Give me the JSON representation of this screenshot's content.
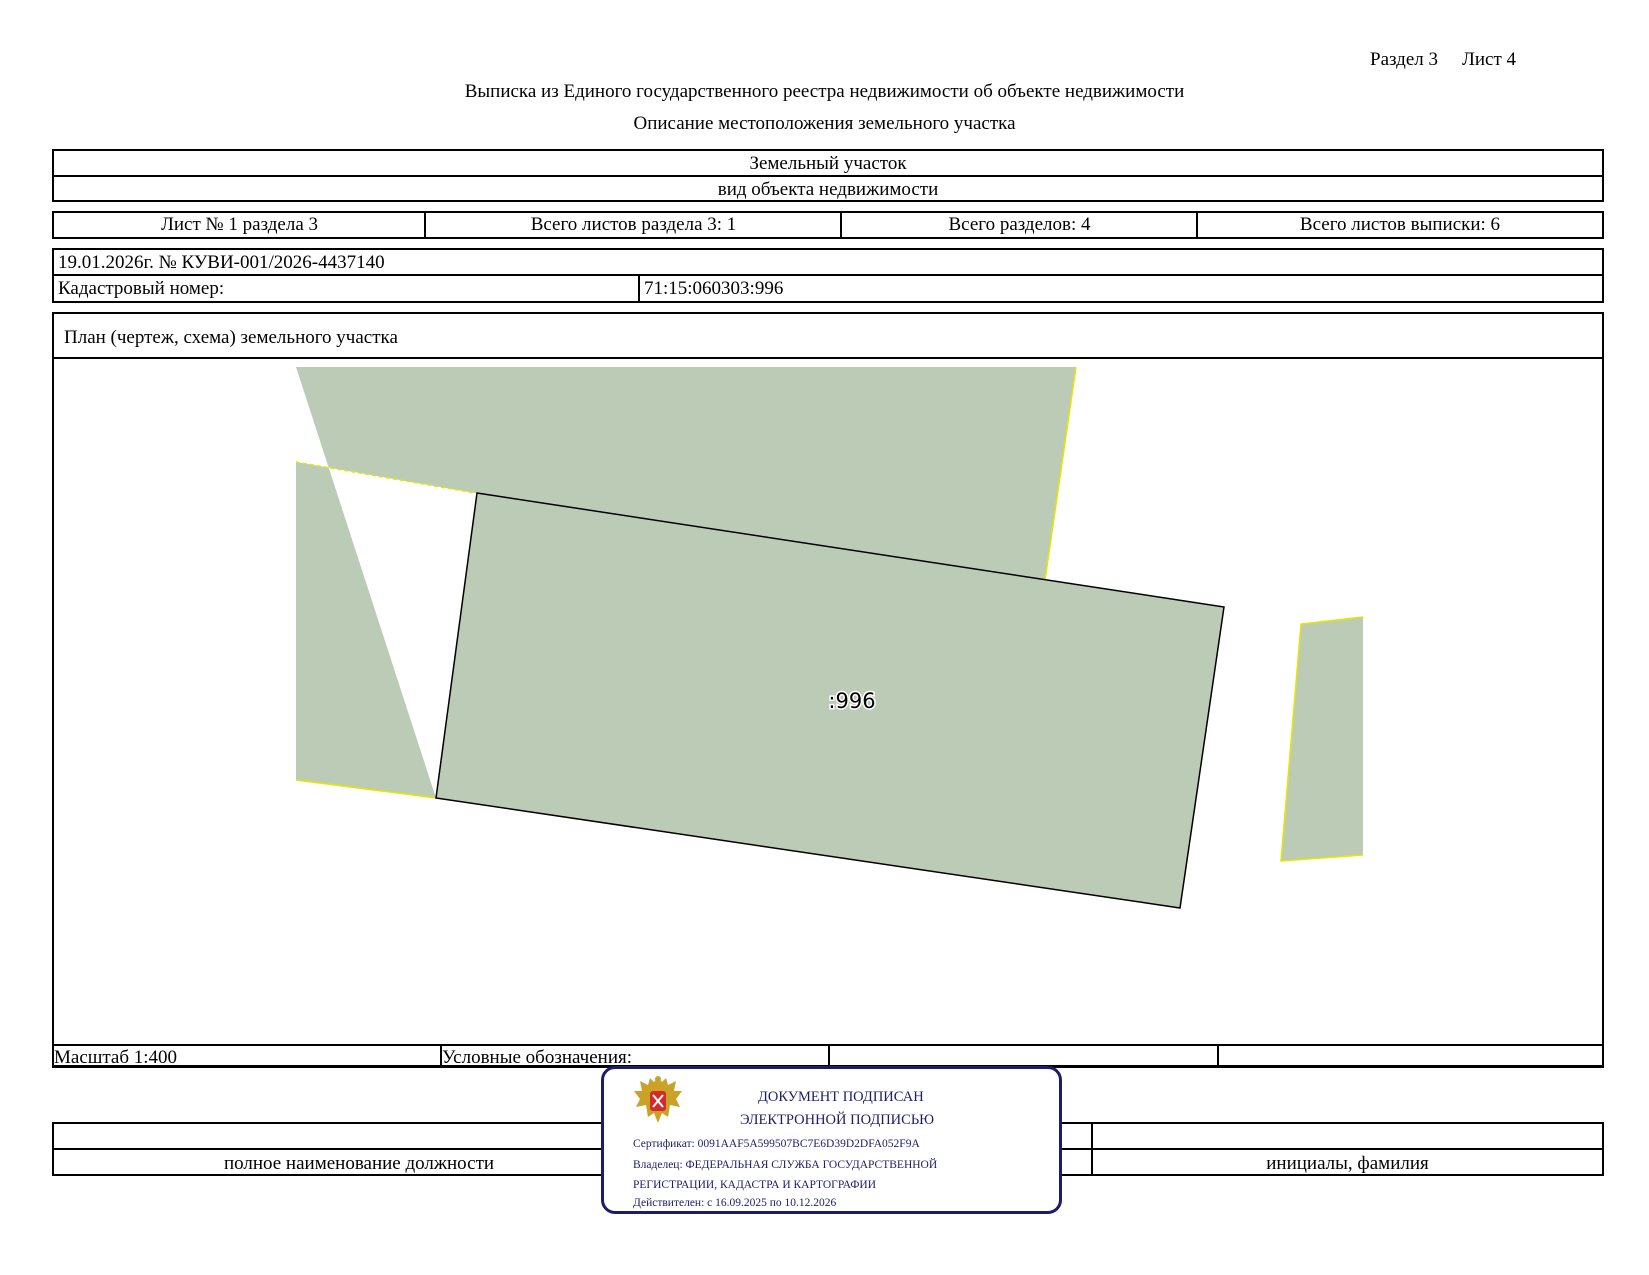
{
  "header": {
    "section_label": "Раздел 3",
    "sheet_label": "Лист 4",
    "title": "Выписка из Единого государственного реестра недвижимости об объекте недвижимости",
    "subtitle": "Описание местоположения земельного участка"
  },
  "object": {
    "type": "Земельный участок",
    "type_caption": "вид объекта недвижимости"
  },
  "sheet_info": {
    "sheet_no": "Лист № 1 раздела 3",
    "total_section_sheets": "Всего листов раздела 3: 1",
    "total_sections": "Всего разделов: 4",
    "total_extract_sheets": "Всего листов выписки: 6"
  },
  "registration": {
    "date_number": "19.01.2026г. № КУВИ-001/2026-4437140",
    "cadastral_label": "Кадастровый номер:",
    "cadastral_number": "71:15:060303:996"
  },
  "plan": {
    "heading": "План (чертеж, схема) земельного участка",
    "parcel_label": ":996",
    "parcel_fill": "#bccbb6",
    "neighbor_edge_color": "#e6e600",
    "scale": "Масштаб 1:400",
    "legend_label": "Условные обозначения:"
  },
  "signature": {
    "position_caption": "полное наименование должности",
    "name_caption": "инициалы, фамилия"
  },
  "stamp": {
    "line1": "ДОКУМЕНТ ПОДПИСАН",
    "line2": "ЭЛЕКТРОННОЙ ПОДПИСЬЮ",
    "certificate": "Сертификат: 0091AAF5A599507BC7E6D39D2DFA052F9A",
    "owner_line1": "Владелец: ФЕДЕРАЛЬНАЯ СЛУЖБА ГОСУДАРСТВЕННОЙ",
    "owner_line2": "РЕГИСТРАЦИИ, КАДАСТРА И КАРТОГРАФИИ",
    "valid": "Действителен: с 16.09.2025 по 10.12.2026",
    "color": "#1d1d66"
  }
}
